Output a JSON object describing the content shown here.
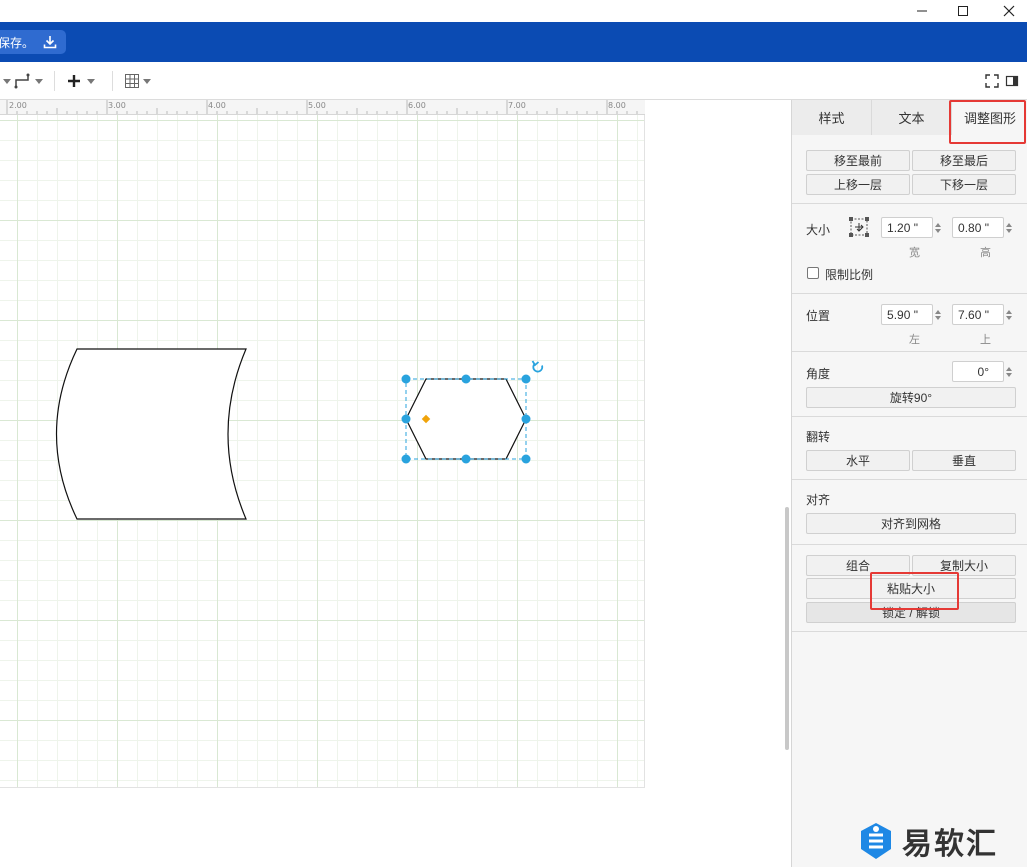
{
  "window": {
    "minimize": "—",
    "maximize": "☐",
    "close": "✕"
  },
  "banner": {
    "save_text": "保存。"
  },
  "ruler": {
    "labels": [
      "2.00",
      "3.00",
      "4.00",
      "5.00",
      "6.00",
      "7.00",
      "8.00"
    ]
  },
  "panel": {
    "tabs": {
      "style": "样式",
      "text": "文本",
      "arrange": "调整图形"
    },
    "order": {
      "to_front": "移至最前",
      "to_back": "移至最后",
      "forward": "上移一层",
      "backward": "下移一层"
    },
    "size": {
      "label": "大小",
      "width_value": "1.20 \"",
      "height_value": "0.80 \"",
      "width_label": "宽",
      "height_label": "高",
      "constrain_label": "限制比例"
    },
    "position": {
      "label": "位置",
      "left_value": "5.90 \"",
      "top_value": "7.60 \"",
      "left_label": "左",
      "top_label": "上"
    },
    "angle": {
      "label": "角度",
      "value": "0°",
      "rotate_button": "旋转90°"
    },
    "flip": {
      "label": "翻转",
      "horizontal": "水平",
      "vertical": "垂直"
    },
    "align": {
      "label": "对齐",
      "snap_button": "对齐到网格"
    },
    "group": {
      "group_button": "组合",
      "copy_size": "复制大小",
      "paste_size": "粘贴大小",
      "lock_unlock": "锁定 / 解锁"
    }
  },
  "watermark": {
    "text": "易软汇"
  },
  "colors": {
    "banner": "#0b4bb3",
    "selection": "#29a3de",
    "highlight": "#e53935",
    "handle_yellow": "#f0a30a"
  }
}
